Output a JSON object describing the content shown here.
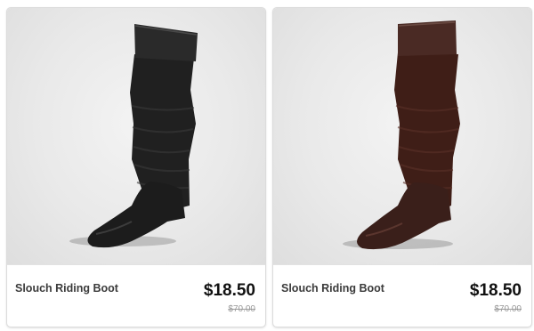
{
  "products": [
    {
      "name": "Slouch Riding Boot",
      "price": "$18.50",
      "original_price": "$70.00",
      "boot_color": "#1c1c1c",
      "shaft_color": "#202020",
      "cuff_color": "#2a2a2a"
    },
    {
      "name": "Slouch Riding Boot",
      "price": "$18.50",
      "original_price": "$70.00",
      "boot_color": "#3a1f1a",
      "shaft_color": "#3f1e17",
      "cuff_color": "#4a2a24"
    }
  ]
}
